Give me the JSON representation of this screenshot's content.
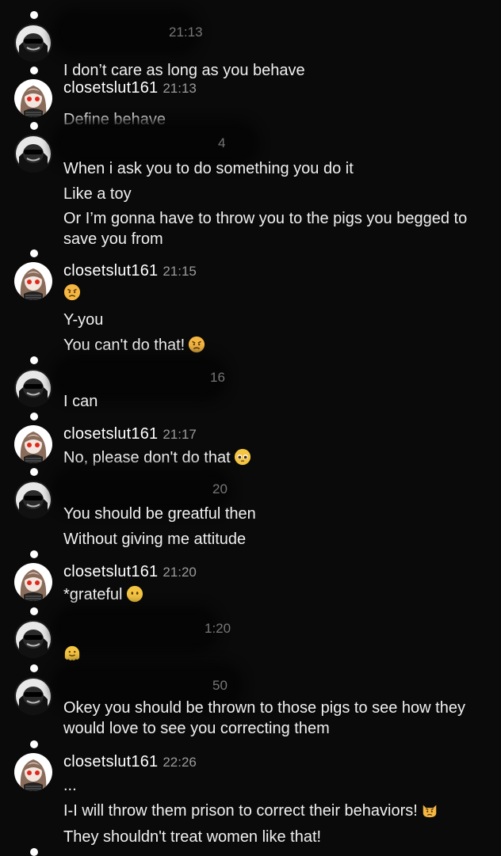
{
  "messages": [
    {
      "user": "",
      "time": "21:13",
      "redacted": true,
      "avatar": "masked",
      "lines": [
        "I don’t care as long as you behave"
      ]
    },
    {
      "user": "closetslut161",
      "time": "21:13",
      "redacted": false,
      "avatar": "girl",
      "lines": [
        "Define behave"
      ]
    },
    {
      "user": "",
      "time": "4",
      "redacted": true,
      "avatar": "masked",
      "lines": [
        "When i ask you to do something you do it",
        "Like a toy",
        "Or I’m gonna have to throw you to the pigs you begged to save you from"
      ]
    },
    {
      "user": "closetslut161",
      "time": "21:15",
      "redacted": false,
      "avatar": "girl",
      "lines": [
        "",
        "Y-you",
        "You can't do that!"
      ]
    },
    {
      "user": "",
      "time": "16",
      "redacted": true,
      "avatar": "masked",
      "lines": [
        "I can"
      ]
    },
    {
      "user": "closetslut161",
      "time": "21:17",
      "redacted": false,
      "avatar": "girl",
      "lines": [
        "No, please don't do that"
      ]
    },
    {
      "user": "",
      "time": "20",
      "redacted": true,
      "avatar": "masked",
      "lines": [
        "You should be greatful then",
        "Without giving me attitude"
      ]
    },
    {
      "user": "closetslut161",
      "time": "21:20",
      "redacted": false,
      "avatar": "girl",
      "lines": [
        "*grateful"
      ]
    },
    {
      "user": "",
      "time": "1:20",
      "redacted": true,
      "avatar": "masked",
      "lines": [
        ""
      ]
    },
    {
      "user": "",
      "time": "50",
      "redacted": true,
      "avatar": "masked",
      "lines": [
        "Okey you should be thrown to those pigs to see how they would love to see you correcting them"
      ]
    },
    {
      "user": "closetslut161",
      "time": "22:26",
      "redacted": false,
      "avatar": "girl",
      "lines": [
        "...",
        "I-I will throw them prison to correct their behaviors!",
        "They shouldn't treat women like that!"
      ]
    }
  ],
  "emojis": {
    "angry": "angry-face",
    "pleading": "pleading-face",
    "no_mouth": "face-without-mouth",
    "melting": "melting-face",
    "pouting_cat": "pouting-cat"
  },
  "colors": {
    "background": "#0a0a0a",
    "text": "#f0f0f0",
    "timestamp": "#9a9a9a",
    "status_dot": "#ffffff"
  }
}
